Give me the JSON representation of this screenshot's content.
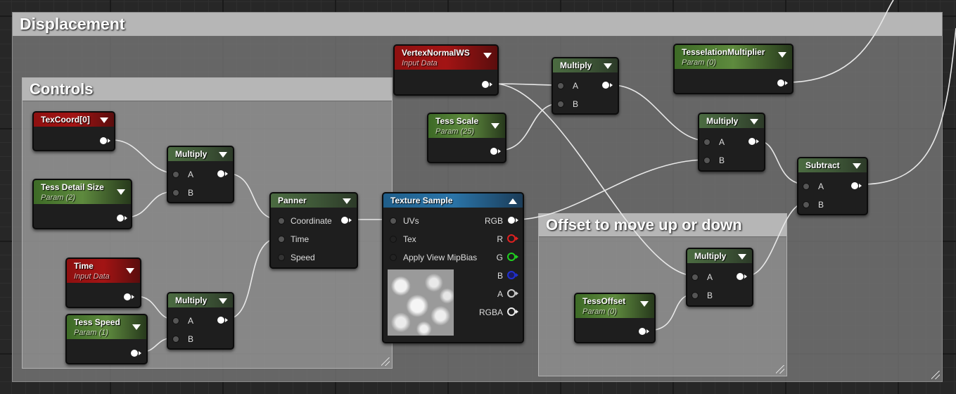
{
  "comments": {
    "displacement": "Displacement",
    "controls": "Controls",
    "offset": "Offset to move up or down"
  },
  "nodes": {
    "texcoord": {
      "title": "TexCoord[0]"
    },
    "tess_detail": {
      "title": "Tess Detail Size",
      "sub": "Param (2)"
    },
    "time": {
      "title": "Time",
      "sub": "Input Data"
    },
    "tess_speed": {
      "title": "Tess Speed",
      "sub": "Param (1)"
    },
    "mul1": {
      "title": "Multiply",
      "a": "A",
      "b": "B"
    },
    "mul2": {
      "title": "Multiply",
      "a": "A",
      "b": "B"
    },
    "panner": {
      "title": "Panner",
      "coordinate": "Coordinate",
      "time": "Time",
      "speed": "Speed"
    },
    "texture_sample": {
      "title": "Texture Sample",
      "uvs": "UVs",
      "tex": "Tex",
      "mipbias": "Apply View MipBias",
      "rgb": "RGB",
      "r": "R",
      "g": "G",
      "b": "B",
      "a": "A",
      "rgba": "RGBA"
    },
    "vertex_normal": {
      "title": "VertexNormalWS",
      "sub": "Input Data"
    },
    "tess_scale": {
      "title": "Tess Scale",
      "sub": "Param (25)"
    },
    "mul3": {
      "title": "Multiply",
      "a": "A",
      "b": "B"
    },
    "tess_mult": {
      "title": "TesselationMultiplier",
      "sub": "Param (0)"
    },
    "mul4": {
      "title": "Multiply",
      "a": "A",
      "b": "B"
    },
    "subtract": {
      "title": "Subtract",
      "a": "A",
      "b": "B"
    },
    "mul5": {
      "title": "Multiply",
      "a": "A",
      "b": "B"
    },
    "tess_offset": {
      "title": "TessOffset",
      "sub": "Param (0)"
    }
  },
  "colors": {
    "r_pin": "#e02020",
    "g_pin": "#20d020",
    "b_pin": "#2030d0",
    "a_pin": "#cccccc",
    "wire": "#e8e8e8"
  }
}
